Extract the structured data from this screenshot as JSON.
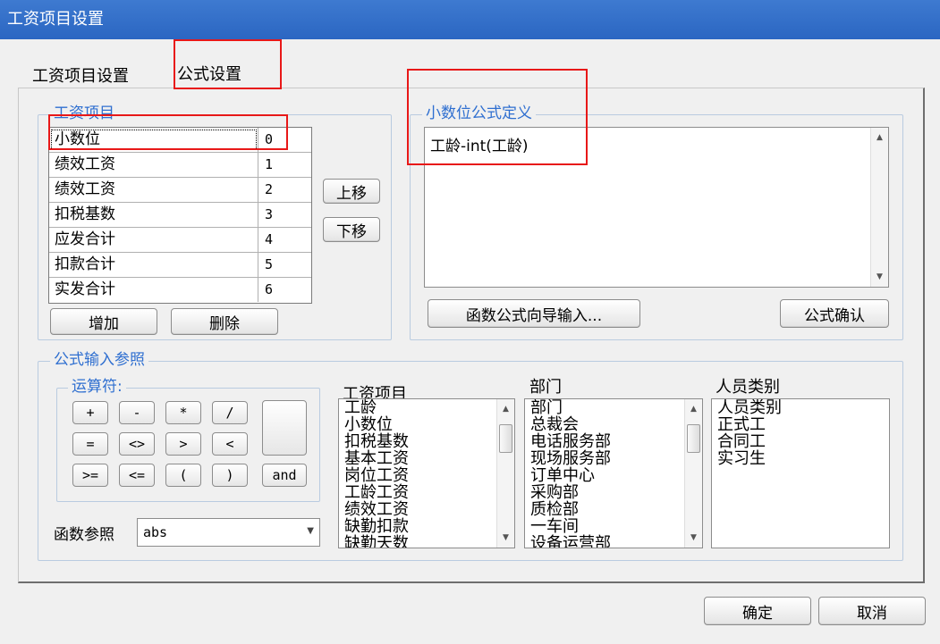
{
  "window": {
    "title": "工资项目设置"
  },
  "tabs": [
    {
      "label": "工资项目设置"
    },
    {
      "label": "公式设置"
    }
  ],
  "salary_items_group": {
    "legend": "工资项目",
    "rows": [
      {
        "name": "小数位",
        "value": "0"
      },
      {
        "name": "绩效工资",
        "value": "1"
      },
      {
        "name": "绩效工资",
        "value": "2"
      },
      {
        "name": "扣税基数",
        "value": "3"
      },
      {
        "name": "应发合计",
        "value": "4"
      },
      {
        "name": "扣款合计",
        "value": "5"
      },
      {
        "name": "实发合计",
        "value": "6"
      }
    ],
    "move_up_label": "上移",
    "move_down_label": "下移",
    "add_label": "增加",
    "delete_label": "删除"
  },
  "formula_def_group": {
    "legend": "小数位公式定义",
    "formula_text": "工龄-int(工龄)",
    "wizard_label": "函数公式向导输入...",
    "confirm_label": "公式确认"
  },
  "formula_ref_group": {
    "legend": "公式输入参照",
    "operators_legend": "运算符:",
    "operators": [
      "+",
      "-",
      "*",
      "/",
      "=",
      "<>",
      ">",
      "<",
      ">=",
      "<=",
      "(",
      ")",
      "and"
    ],
    "function_label": "函数参照",
    "function_selected": "abs",
    "salary_items_header": "工资项目",
    "salary_items": [
      "工龄",
      "小数位",
      "扣税基数",
      "基本工资",
      "岗位工资",
      "工龄工资",
      "绩效工资",
      "缺勤扣款",
      "缺勤天数"
    ],
    "departments_header": "部门",
    "departments": [
      "部门",
      "总裁会",
      "电话服务部",
      "现场服务部",
      "订单中心",
      "采购部",
      "质检部",
      "一车间",
      "设备运营部"
    ],
    "personnel_header": "人员类别",
    "personnel": [
      "人员类别",
      "正式工",
      "合同工",
      "实习生"
    ]
  },
  "footer": {
    "ok_label": "确定",
    "cancel_label": "取消"
  }
}
